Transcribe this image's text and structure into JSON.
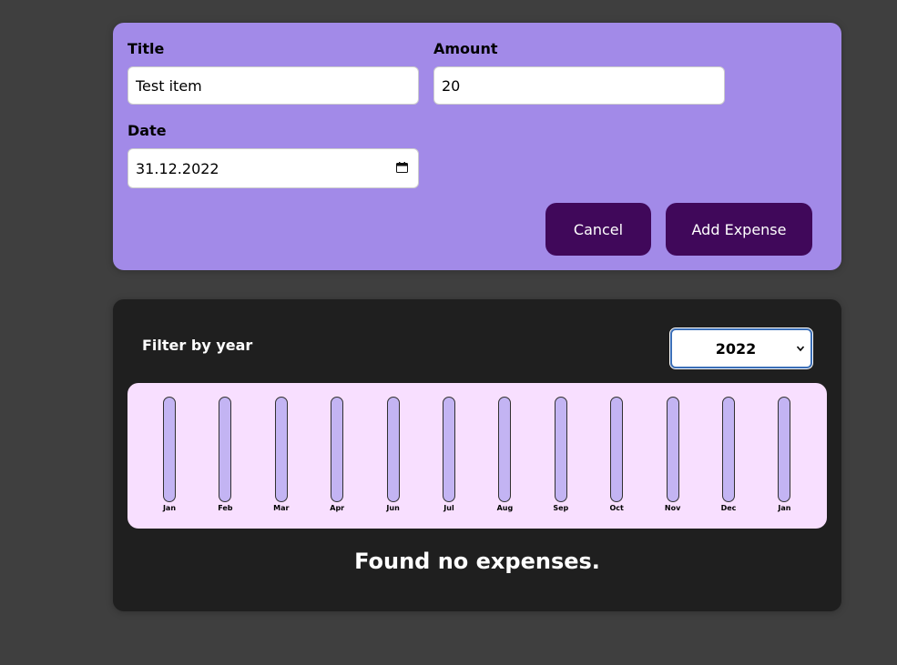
{
  "form": {
    "title_label": "Title",
    "title_value": "Test item",
    "amount_label": "Amount",
    "amount_value": "20",
    "date_label": "Date",
    "date_value": "31.12.2022",
    "cancel_label": "Cancel",
    "submit_label": "Add Expense"
  },
  "filter": {
    "label": "Filter by year",
    "selected_year": "2022"
  },
  "chart": {
    "months": [
      {
        "label": "Jan",
        "fill": 0
      },
      {
        "label": "Feb",
        "fill": 0
      },
      {
        "label": "Mar",
        "fill": 0
      },
      {
        "label": "Apr",
        "fill": 0
      },
      {
        "label": "Jun",
        "fill": 0
      },
      {
        "label": "Jul",
        "fill": 0
      },
      {
        "label": "Aug",
        "fill": 0
      },
      {
        "label": "Sep",
        "fill": 0
      },
      {
        "label": "Oct",
        "fill": 0
      },
      {
        "label": "Nov",
        "fill": 0
      },
      {
        "label": "Dec",
        "fill": 0
      },
      {
        "label": "Jan",
        "fill": 0
      }
    ]
  },
  "empty_message": "Found no expenses.",
  "colors": {
    "form_background": "#a28ae8",
    "button_background": "#40085a",
    "panel_background": "#1f1f1f",
    "chart_background": "#f8dfff",
    "bar_background": "#c3b4f3"
  }
}
